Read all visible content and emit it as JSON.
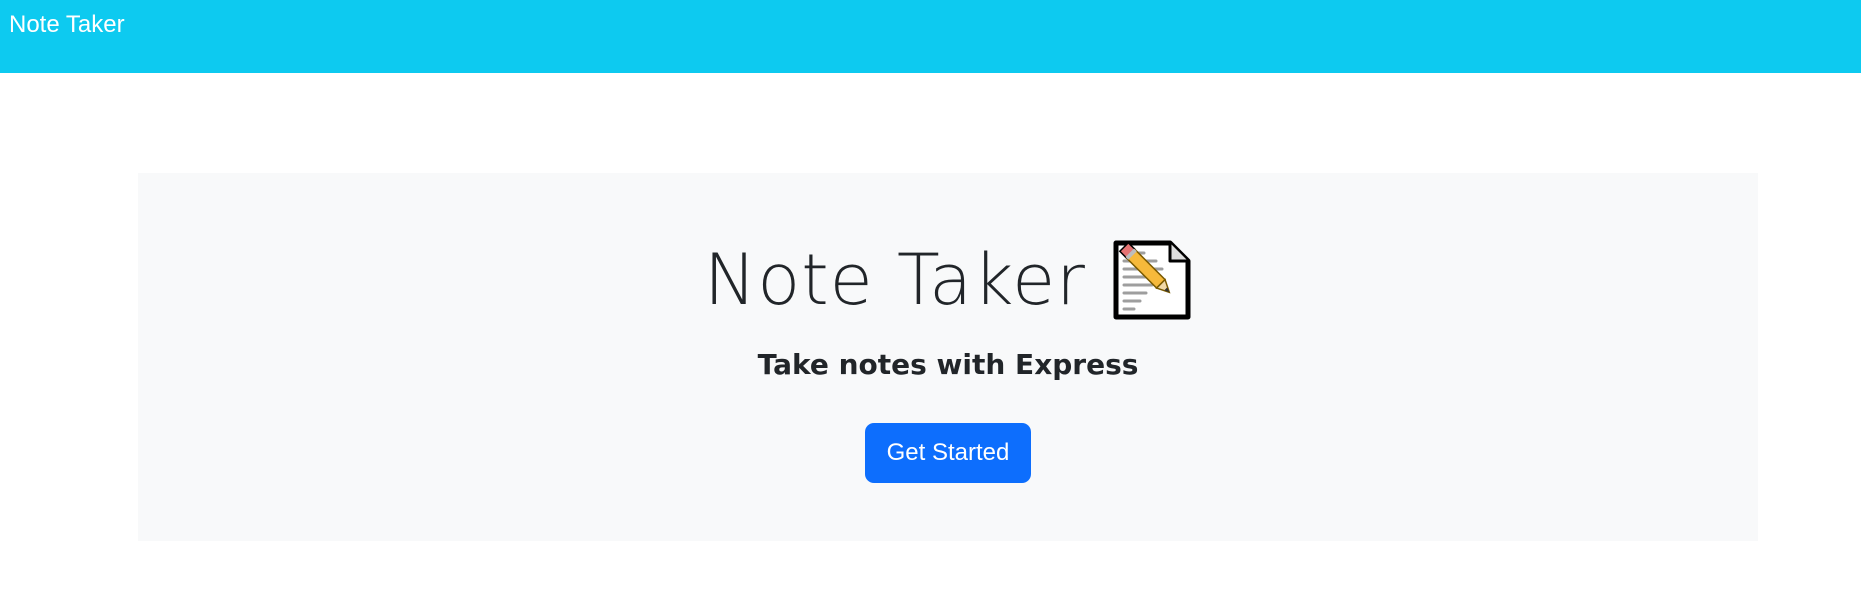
{
  "navbar": {
    "brand": "Note Taker",
    "background_color": "#0dcaf0"
  },
  "hero": {
    "title": "Note Taker",
    "title_icon": "memo-icon",
    "lead": "Take notes with Express",
    "button_label": "Get Started",
    "button_color": "#0d6efd",
    "background_color": "#f8f9fa"
  }
}
